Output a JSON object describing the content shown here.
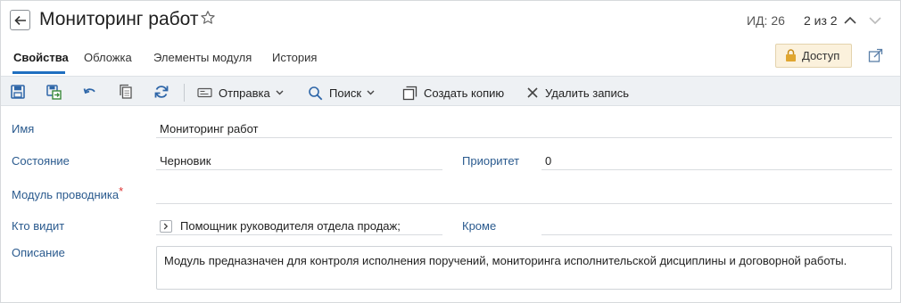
{
  "header": {
    "title": "Мониторинг работ",
    "record_id": "ИД: 26",
    "pager": "2 из 2"
  },
  "tabs": [
    {
      "label": "Свойства",
      "active": true
    },
    {
      "label": "Обложка",
      "active": false
    },
    {
      "label": "Элементы модуля",
      "active": false
    },
    {
      "label": "История",
      "active": false
    }
  ],
  "access_button": {
    "label": "Доступ"
  },
  "toolbar": {
    "icons": [
      "save-icon",
      "save-and-close-icon",
      "undo-icon",
      "copy-icon",
      "refresh-icon"
    ],
    "send_label": "Отправка",
    "search_label": "Поиск",
    "create_copy_label": "Создать копию",
    "delete_label": "Удалить запись"
  },
  "form": {
    "name_label": "Имя",
    "name_value": "Мониторинг работ",
    "state_label": "Состояние",
    "state_value": "Черновик",
    "priority_label": "Приоритет",
    "priority_value": "0",
    "module_label": "Модуль проводника",
    "module_required_mark": "*",
    "visibility_label": "Кто видит",
    "visibility_value": "Помощник руководителя отдела продаж;",
    "except_label": "Кроме",
    "description_label": "Описание",
    "description_value": "Модуль предназначен для контроля исполнения поручений, мониторинга исполнительской дисциплины и договорной работы."
  },
  "colors": {
    "accent": "#1f6fc0",
    "label_blue": "#2a5a8e",
    "toolbar_bg": "#eef1f4",
    "access_bg": "#fbf1dc"
  }
}
